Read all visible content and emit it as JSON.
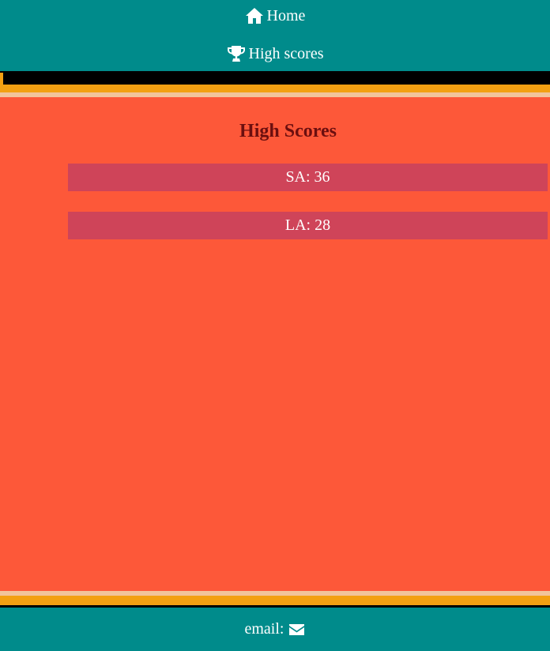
{
  "nav": {
    "items": [
      {
        "label": "Home",
        "icon": "home-icon"
      },
      {
        "label": "High scores",
        "icon": "trophy-icon"
      }
    ]
  },
  "main": {
    "title": "High Scores",
    "scores": [
      {
        "text": "SA: 36"
      },
      {
        "text": "LA: 28"
      }
    ]
  },
  "footer": {
    "email_label": "email:",
    "email_icon": "envelope-icon"
  },
  "colors": {
    "nav_bg": "#008b8b",
    "main_bg": "#fd5839",
    "score_row_bg": "#cf4459",
    "title_color": "#6b0f0f",
    "accent_orange": "#f3a012",
    "accent_cream": "#f2c49b"
  }
}
